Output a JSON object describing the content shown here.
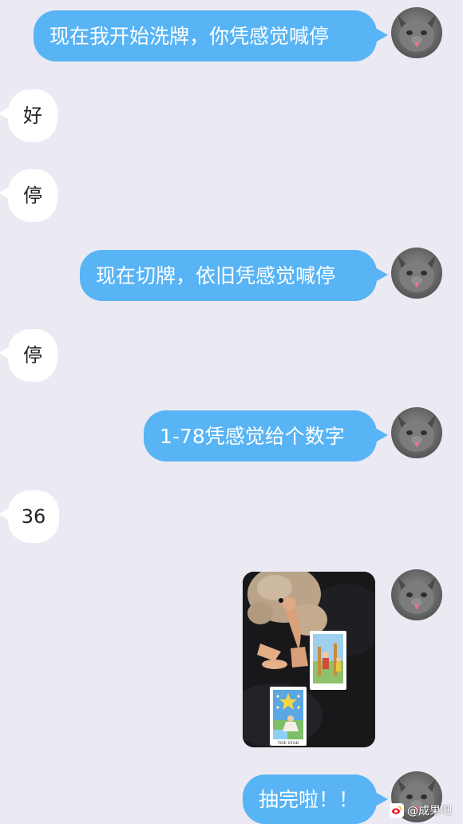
{
  "messages": [
    {
      "side": "out",
      "text": "现在我开始洗牌，你凭感觉喊停"
    },
    {
      "side": "in",
      "text": "好"
    },
    {
      "side": "in",
      "text": "停"
    },
    {
      "side": "out",
      "text": "现在切牌，依旧凭感觉喊停"
    },
    {
      "side": "in",
      "text": "停"
    },
    {
      "side": "out",
      "text": "1-78凭感觉给个数字"
    },
    {
      "side": "in",
      "text": "36"
    },
    {
      "side": "out",
      "type": "image",
      "content": "plush toy with two tarot cards"
    },
    {
      "side": "out",
      "text": "抽完啦！！"
    }
  ],
  "photo": {
    "card_label": "THE STAR"
  },
  "watermark": {
    "text": "@成果吧"
  },
  "colors": {
    "background": "#ebeaf3",
    "outgoing_bubble": "#58b4f4",
    "incoming_bubble": "#ffffff",
    "outgoing_text": "#ffffff"
  },
  "icons": {
    "avatar": "cat-avatar-icon",
    "watermark": "weibo-logo-icon"
  }
}
